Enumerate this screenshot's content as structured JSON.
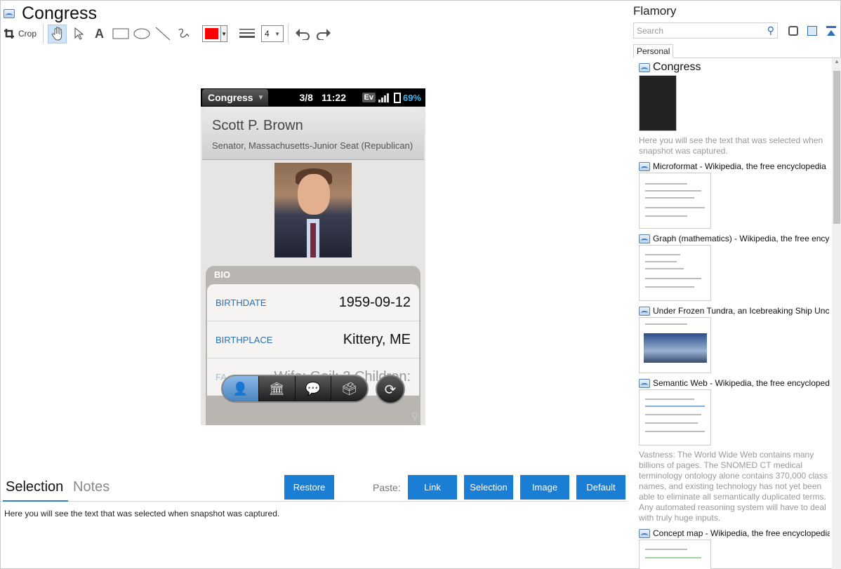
{
  "window": {
    "title": "Congress"
  },
  "toolbar": {
    "crop_label": "Crop",
    "line_width": "4",
    "color": "#ff0000"
  },
  "phone": {
    "app_name": "Congress",
    "date": "3/8",
    "time": "11:22",
    "network": "Ev",
    "battery_pct": "69%",
    "name": "Scott P. Brown",
    "role": "Senator, Massachusetts-Junior Seat (Republican)",
    "bio_label": "BIO",
    "bio": [
      {
        "key": "BIRTHDATE",
        "value": "1959-09-12"
      },
      {
        "key": "BIRTHPLACE",
        "value": "Kittery, ME"
      },
      {
        "key": "FA",
        "value": "Wife: Gail; 2 Children:"
      }
    ]
  },
  "bottom": {
    "tab_selection": "Selection",
    "tab_notes": "Notes",
    "restore": "Restore",
    "paste_label": "Paste:",
    "paste_link": "Link",
    "paste_selection": "Selection",
    "paste_image": "Image",
    "paste_default": "Default",
    "selection_text": "Here you will see the text that was selected when snapshot was captured."
  },
  "sidebar": {
    "title": "Flamory",
    "search_placeholder": "Search",
    "tab": "Personal",
    "items": [
      {
        "title": "Congress",
        "desc": "Here you will see the text that was selected when snapshot was captured."
      },
      {
        "title": "Microformat - Wikipedia, the free encyclopedia"
      },
      {
        "title": "Graph (mathematics) - Wikipedia, the free encyclopedia"
      },
      {
        "title": "Under Frozen Tundra, an Icebreaking Ship Uncovers"
      },
      {
        "title": "Semantic Web - Wikipedia, the free encyclopedia",
        "desc": "Vastness: The World Wide Web contains many billions of pages. The SNOMED CT medical terminology ontology alone contains 370,000 class names, and existing technology has not yet been able to eliminate all semantically duplicated terms. Any automated reasoning system will have to deal with truly huge inputs."
      },
      {
        "title": "Concept map - Wikipedia, the free encyclopedia"
      }
    ]
  }
}
